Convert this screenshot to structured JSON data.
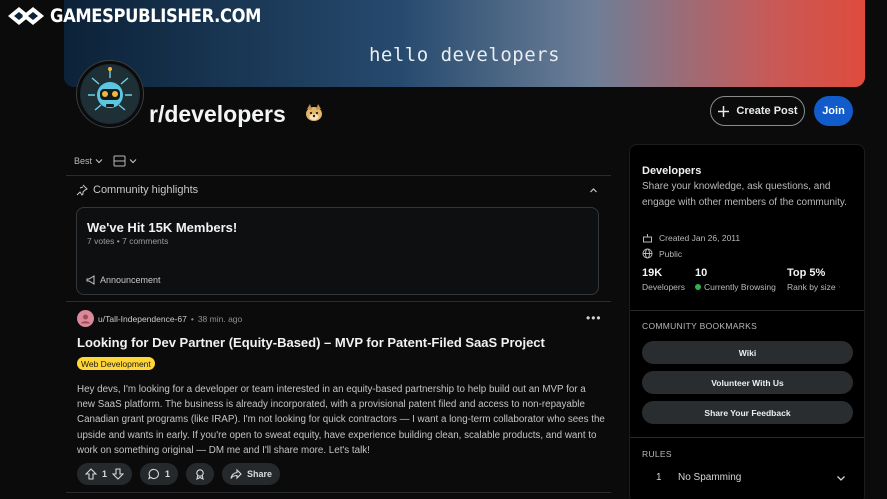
{
  "watermark": {
    "text": "GAMESPUBLISHER.COM"
  },
  "banner": {
    "text": "hello developers"
  },
  "subreddit": {
    "name": "r/developers"
  },
  "header_actions": {
    "create_post": "Create Post",
    "join": "Join"
  },
  "feed": {
    "sort_label": "Best",
    "highlights": {
      "heading": "Community highlights",
      "card_title": "We've Hit 15K Members!",
      "card_meta": "7 votes • 7 comments",
      "card_tag": "Announcement"
    },
    "post": {
      "author": "u/Tall-Independence-67",
      "time": "38 min. ago",
      "title": "Looking for Dev Partner (Equity-Based) – MVP for Patent-Filed SaaS Project",
      "flair": "Web Development",
      "body": "Hey devs, I'm looking for a developer or team interested in an equity-based partnership to help build out an MVP for a new SaaS platform. The business is already incorporated, with a provisional patent filed and access to non-repayable Canadian grant programs (like IRAP). I'm not looking for quick contractors — I want a long-term collaborator who sees the upside and wants in early. If you're open to sweat equity, have experience building clean, scalable products, and want to work on something original — DM me and I'll share more. Let's talk!",
      "votes": "1",
      "comments": "1",
      "share": "Share"
    }
  },
  "sidebar": {
    "name": "Developers",
    "description": "Share your knowledge, ask questions, and engage with other members of the community.",
    "created": "Created Jan 26, 2011",
    "visibility": "Public",
    "stats": [
      {
        "value": "19K",
        "label": "Developers"
      },
      {
        "value": "10",
        "label": "Currently Browsing"
      },
      {
        "value": "Top 5%",
        "label": "Rank by size"
      }
    ],
    "bookmarks_heading": "COMMUNITY BOOKMARKS",
    "bookmarks": [
      "Wiki",
      "Volunteer With Us",
      "Share Your Feedback"
    ],
    "rules_heading": "RULES",
    "rules": [
      {
        "number": "1",
        "title": "No Spamming"
      }
    ]
  },
  "colors": {
    "join": "#115bca",
    "flair": "#ffd635",
    "online": "#2fb24c"
  }
}
